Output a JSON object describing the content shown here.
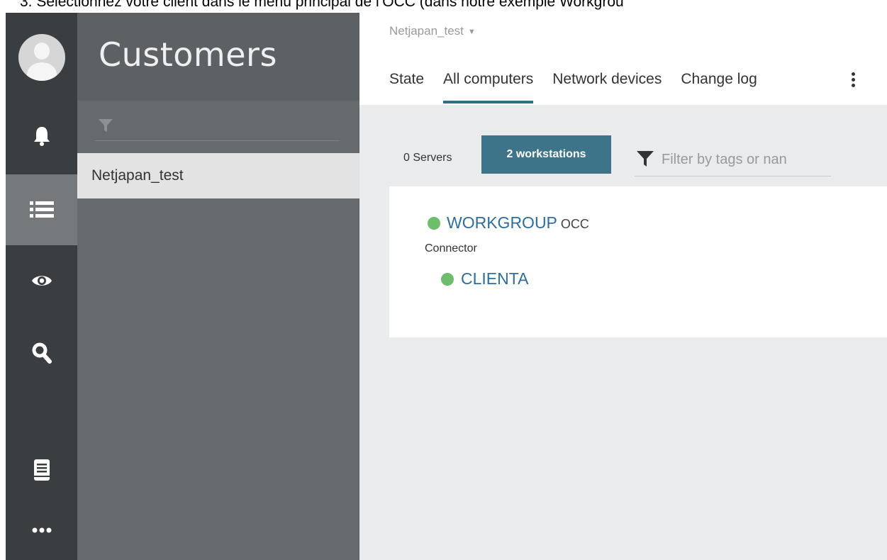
{
  "caption": "3.   Sélectionnez votre client dans le menu principal de l’OCC (dans notre exemple Workgrou",
  "rail": {
    "icons": [
      "avatar",
      "bell-icon",
      "list-icon",
      "eye-icon",
      "search-icon",
      "book-icon",
      "more-icon"
    ],
    "active": "list-icon"
  },
  "panel": {
    "title": "Customers",
    "filter_icon": "filter-icon",
    "customers": [
      "Netjapan_test"
    ]
  },
  "header": {
    "context": "Netjapan_test",
    "tabs": [
      {
        "label": "State"
      },
      {
        "label": "All computers"
      },
      {
        "label": "Network devices"
      },
      {
        "label": "Change log"
      }
    ],
    "active_tab": "All computers"
  },
  "filters": {
    "servers": "0 Servers",
    "workstations": "2 workstations",
    "tag_placeholder": "Filter by tags or nan"
  },
  "tree": {
    "group_name": "WORKGROUP",
    "group_suffix": "OCC",
    "connector": "Connector",
    "computer": "CLIENTA"
  },
  "colors": {
    "rail": "#3b3e40",
    "panel": "#676a6d",
    "accent": "#3e7489",
    "online": "#6dbd6b",
    "link": "#2f6e9b"
  }
}
